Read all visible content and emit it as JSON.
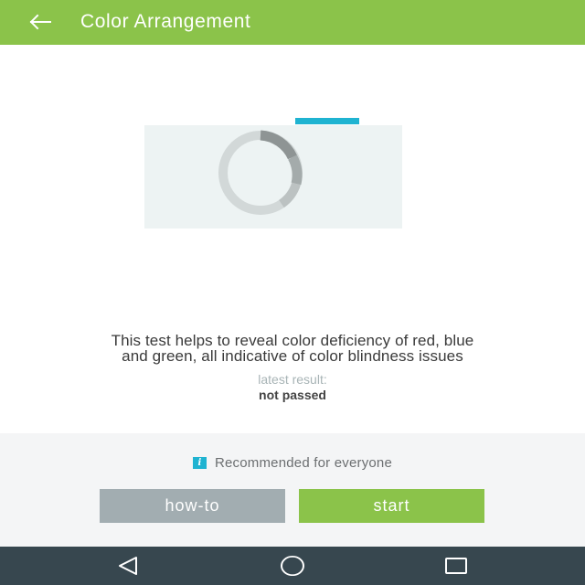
{
  "header": {
    "title": "Color Arrangement",
    "back_icon": "arrow-left-icon",
    "background": "#8bc34a"
  },
  "preview": {
    "accent_color": "#1fb3d1",
    "background": "#edf3f3"
  },
  "main": {
    "description_line1": "This test helps to reveal color deficiency of red, blue",
    "description_line2": "and green, all indicative of color blindness issues",
    "result_label": "latest result:",
    "result_value": "not passed"
  },
  "footer": {
    "info_icon": "i",
    "recommendation": "Recommended for everyone",
    "howto_label": "how-to",
    "start_label": "start",
    "howto_color": "#a2adb1",
    "start_color": "#8bc34a"
  },
  "nav": {
    "icons": [
      "back-triangle-icon",
      "home-circle-icon",
      "recents-square-icon"
    ],
    "background": "#37474f"
  }
}
